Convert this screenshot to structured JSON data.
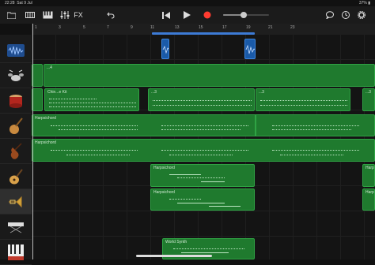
{
  "status": {
    "time": "22:28",
    "date": "Sat 9 Jul",
    "battery": "37%"
  },
  "toolbar": {
    "fx_label": "FX"
  },
  "ruler": {
    "bars": [
      "1",
      "3",
      "5",
      "7",
      "9",
      "11",
      "13",
      "15",
      "17",
      "19",
      "21",
      "23"
    ]
  },
  "tracks": [
    {
      "icon": "audio-waveform-icon"
    },
    {
      "icon": "drum-kit-icon"
    },
    {
      "icon": "taiko-drum-icon"
    },
    {
      "icon": "pipa-icon"
    },
    {
      "icon": "violin-icon"
    },
    {
      "icon": "acoustic-guitar-icon"
    },
    {
      "icon": "brass-icon"
    },
    {
      "icon": "keyboard-stand-icon"
    },
    {
      "icon": "world-piano-icon"
    }
  ],
  "regions": {
    "drums1_label": "...4",
    "chinese_kit_label": "Chin...e Kit",
    "kit_small1_label": "...3",
    "kit_small2_label": "...3",
    "kit_small3_label": "...3",
    "kit_small4_label": "...3",
    "harpsichord_label": "Harpsichord",
    "world_synth_label": "World Synth"
  },
  "colors": {
    "midi_region": "#1f7a2e",
    "audio_region": "#1a5aa8",
    "cycle": "#3d7bd6",
    "record": "#ff3b30"
  }
}
